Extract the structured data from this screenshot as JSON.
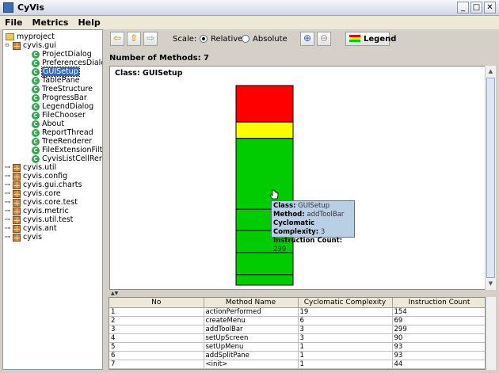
{
  "window": {
    "title": "CyVis"
  },
  "menu": [
    {
      "label": "File"
    },
    {
      "label": "Metrics"
    },
    {
      "label": "Help"
    }
  ],
  "tree": {
    "root": "myproject",
    "nodes": [
      {
        "label": "cyvis.gui",
        "kind": "package",
        "expanded": true
      },
      {
        "label": "ProjectDialog",
        "kind": "class"
      },
      {
        "label": "PreferencesDialog",
        "kind": "class"
      },
      {
        "label": "GUISetup",
        "kind": "class",
        "selected": true
      },
      {
        "label": "TablePane",
        "kind": "class"
      },
      {
        "label": "TreeStructure",
        "kind": "class"
      },
      {
        "label": "ProgressBar",
        "kind": "class"
      },
      {
        "label": "LegendDialog",
        "kind": "class"
      },
      {
        "label": "FileChooser",
        "kind": "class"
      },
      {
        "label": "About",
        "kind": "class"
      },
      {
        "label": "ReportThread",
        "kind": "class"
      },
      {
        "label": "TreeRenderer",
        "kind": "class"
      },
      {
        "label": "FileExtensionFilter",
        "kind": "class"
      },
      {
        "label": "CyvisListCellRender",
        "kind": "class"
      },
      {
        "label": "cyvis.util",
        "kind": "package"
      },
      {
        "label": "cyvis.config",
        "kind": "package"
      },
      {
        "label": "cyvis.gui.charts",
        "kind": "package"
      },
      {
        "label": "cyvis.core",
        "kind": "package"
      },
      {
        "label": "cyvis.core.test",
        "kind": "package"
      },
      {
        "label": "cyvis.metric",
        "kind": "package"
      },
      {
        "label": "cyvis.util.test",
        "kind": "package"
      },
      {
        "label": "cyvis.ant",
        "kind": "package"
      },
      {
        "label": "cyvis",
        "kind": "package"
      }
    ]
  },
  "toolbar": {
    "scale_label": "Scale:",
    "relative_label": "Relative",
    "absolute_label": "Absolute",
    "scale_selected": "Relative",
    "legend_label": "Legend"
  },
  "summary": {
    "method_count": "Number of Methods: 7"
  },
  "chart_panel": {
    "title": "Class: GUISetup"
  },
  "colors": {
    "high": "#ff0000",
    "medium": "#ffff00",
    "low": "#00cc00"
  },
  "chart_data": {
    "type": "bar",
    "orientation": "stacked-vertical",
    "unit": "Instruction Count",
    "segments": [
      {
        "method": "actionPerformed",
        "instruction_count": 154,
        "complexity": 19,
        "color": "#ff0000"
      },
      {
        "method": "createMenu",
        "instruction_count": 69,
        "complexity": 6,
        "color": "#ffff00"
      },
      {
        "method": "addToolBar",
        "instruction_count": 299,
        "complexity": 3,
        "color": "#00cc00"
      },
      {
        "method": "setUpScreen",
        "instruction_count": 90,
        "complexity": 3,
        "color": "#00cc00"
      },
      {
        "method": "setUpMenu",
        "instruction_count": 93,
        "complexity": 1,
        "color": "#00cc00"
      },
      {
        "method": "addSplitPane",
        "instruction_count": 93,
        "complexity": 1,
        "color": "#00cc00"
      },
      {
        "method": "<init>",
        "instruction_count": 44,
        "complexity": 1,
        "color": "#00cc00"
      }
    ]
  },
  "tooltip": {
    "class_key": "Class:",
    "class_val": "GUISetup",
    "method_key": "Method:",
    "method_val": "addToolBar",
    "cc_key": "Cyclomatic Complexity:",
    "cc_val": "3",
    "ic_key": "Instruction Count:",
    "ic_val": "299"
  },
  "table": {
    "columns": [
      "No",
      "Method Name",
      "Cyclomatic Complexity",
      "Instruction Count"
    ],
    "rows": [
      [
        "1",
        "actionPerformed",
        "19",
        "154"
      ],
      [
        "2",
        "createMenu",
        "6",
        "69"
      ],
      [
        "3",
        "addToolBar",
        "3",
        "299"
      ],
      [
        "4",
        "setUpScreen",
        "3",
        "90"
      ],
      [
        "5",
        "setUpMenu",
        "1",
        "93"
      ],
      [
        "6",
        "addSplitPane",
        "1",
        "93"
      ],
      [
        "7",
        "<init>",
        "1",
        "44"
      ]
    ]
  }
}
